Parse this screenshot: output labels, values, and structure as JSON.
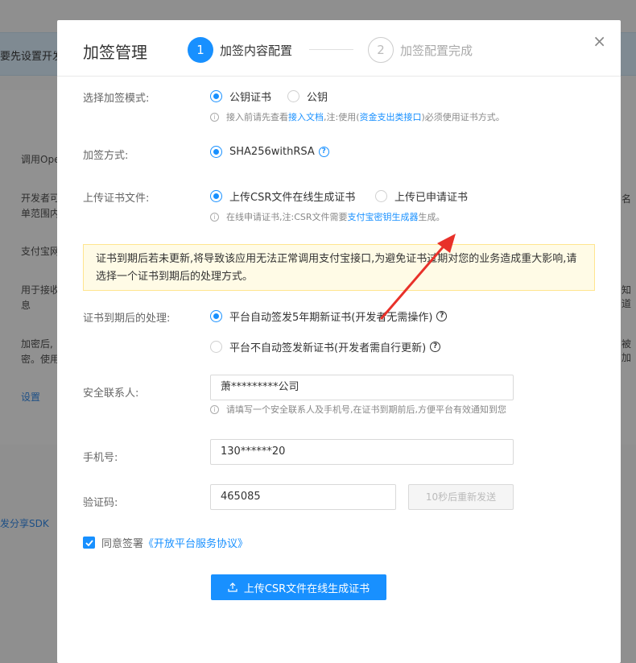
{
  "background": {
    "banner_text": "要先设置开发",
    "left_texts": [
      "调用Ope",
      "开发者可",
      "单范围内",
      "支付宝网",
      "用于接收",
      "息",
      "加密后,",
      "密。使用"
    ],
    "link_settings": "设置",
    "link_sdk": "发分享SDK",
    "right_texts": [
      "名",
      "知道",
      "被加"
    ]
  },
  "modal": {
    "title": "加签管理",
    "close": "×",
    "steps": [
      {
        "number": "1",
        "label": "加签内容配置"
      },
      {
        "number": "2",
        "label": "加签配置完成"
      }
    ]
  },
  "form": {
    "sign_mode": {
      "label": "选择加签模式:",
      "options": [
        "公钥证书",
        "公钥"
      ],
      "selected": "公钥证书",
      "hint_prefix": "接入前请先查看",
      "hint_link1": "接入文档",
      "hint_middle": ",注:使用(",
      "hint_link2": "资金支出类接口",
      "hint_suffix": ")必须使用证书方式。"
    },
    "sign_method": {
      "label": "加签方式:",
      "option": "SHA256withRSA"
    },
    "upload_cert": {
      "label": "上传证书文件:",
      "options": [
        "上传CSR文件在线生成证书",
        "上传已申请证书"
      ],
      "selected": "上传CSR文件在线生成证书",
      "hint_prefix": "在线申请证书,注:CSR文件需要",
      "hint_link": "支付宝密钥生成器",
      "hint_suffix": "生成。"
    },
    "alert": "证书到期后若未更新,将导致该应用无法正常调用支付宝接口,为避免证书过期对您的业务造成重大影响,请选择一个证书到期后的处理方式。",
    "expiry": {
      "label": "证书到期后的处理:",
      "options": [
        "平台自动签发5年期新证书(开发者无需操作)",
        "平台不自动签发新证书(开发者需自行更新)"
      ],
      "selected": "平台自动签发5年期新证书(开发者无需操作)"
    },
    "contact": {
      "label": "安全联系人:",
      "value": "萧*********公司",
      "hint": "请填写一个安全联系人及手机号,在证书到期前后,方便平台有效通知到您"
    },
    "phone": {
      "label": "手机号:",
      "value": "130******20"
    },
    "code": {
      "label": "验证码:",
      "value": "465085",
      "resend": "10秒后重新发送"
    },
    "agreement": {
      "text": "同意签署",
      "link": "《开放平台服务协议》",
      "checked": true
    },
    "submit": "上传CSR文件在线生成证书"
  },
  "colors": {
    "primary": "#1890ff",
    "arrow": "#e8312a",
    "alert_bg": "#fffbe6"
  }
}
